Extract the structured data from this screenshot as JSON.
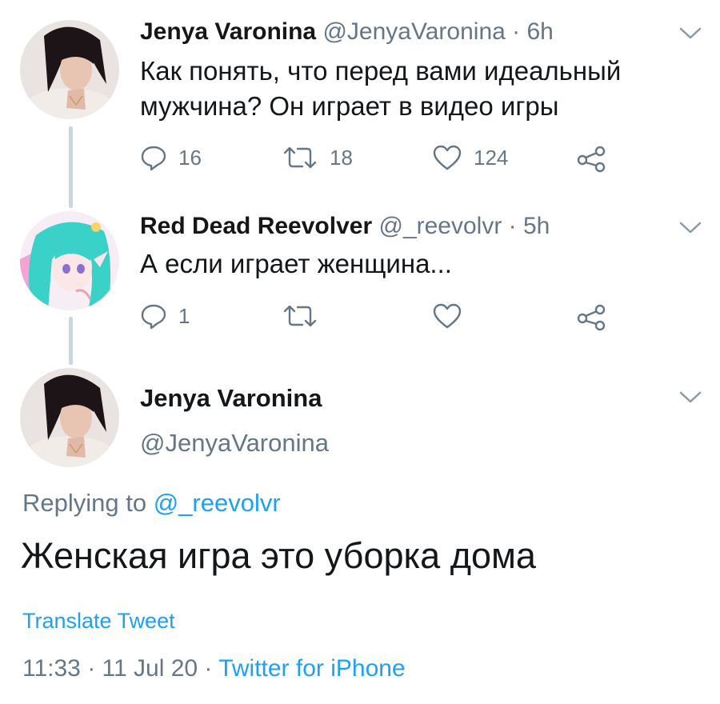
{
  "tweets": [
    {
      "name": "Jenya Varonina",
      "handle": "@JenyaVaronina",
      "separator": " · ",
      "time": "6h",
      "text_line1": "Как понять, что перед вами идеальный",
      "text_line2": "мужчина? Он играет в видео игры",
      "replies": "16",
      "retweets": "18",
      "likes": "124"
    },
    {
      "name": "Red Dead Reevolver",
      "handle": "@_reevolvr",
      "separator": " · ",
      "time": "5h",
      "text_line1": "А если играет женщина...",
      "replies": "1",
      "retweets": "",
      "likes": ""
    }
  ],
  "main_tweet": {
    "name": "Jenya Varonina",
    "handle": "@JenyaVaronina",
    "replying_prefix": "Replying to ",
    "replying_mention": "@_reevolvr",
    "text": "Женская игра это уборка дома",
    "translate": "Translate Tweet",
    "time": "11:33",
    "date": "11 Jul 20",
    "sep": " · ",
    "source": "Twitter for iPhone"
  },
  "colors": {
    "accent": "#1da1f2",
    "secondary_text": "#657786",
    "thread_line": "#ccd6dd",
    "icon": "#657786"
  },
  "icons": [
    "reply-icon",
    "retweet-icon",
    "like-icon",
    "share-icon",
    "chevron-down-icon"
  ]
}
